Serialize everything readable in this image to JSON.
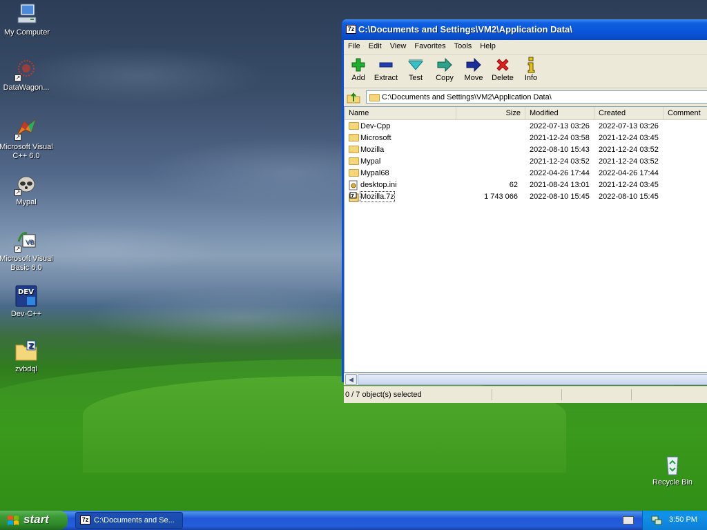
{
  "desktop": {
    "icons": [
      {
        "label": "My Computer"
      },
      {
        "label": "DataWagon..."
      },
      {
        "label": "Microsoft Visual C++ 6.0"
      },
      {
        "label": "Mypal"
      },
      {
        "label": "Microsoft Visual Basic 6.0"
      },
      {
        "label": "Dev-C++"
      },
      {
        "label": "zvbdql"
      },
      {
        "label": "Recycle Bin"
      }
    ]
  },
  "window": {
    "title": "C:\\Documents and Settings\\VM2\\Application Data\\",
    "app_badge": "7z",
    "menu": [
      "File",
      "Edit",
      "View",
      "Favorites",
      "Tools",
      "Help"
    ],
    "toolbar": [
      "Add",
      "Extract",
      "Test",
      "Copy",
      "Move",
      "Delete",
      "Info"
    ],
    "address": "C:\\Documents and Settings\\VM2\\Application Data\\",
    "columns": [
      "Name",
      "Size",
      "Modified",
      "Created",
      "Comment"
    ],
    "rows": [
      {
        "name": "Dev-Cpp",
        "size": "",
        "modified": "2022-07-13 03:26",
        "created": "2022-07-13 03:26",
        "type": "folder"
      },
      {
        "name": "Microsoft",
        "size": "",
        "modified": "2021-12-24 03:58",
        "created": "2021-12-24 03:45",
        "type": "folder"
      },
      {
        "name": "Mozilla",
        "size": "",
        "modified": "2022-08-10 15:43",
        "created": "2021-12-24 03:52",
        "type": "folder"
      },
      {
        "name": "Mypal",
        "size": "",
        "modified": "2021-12-24 03:52",
        "created": "2021-12-24 03:52",
        "type": "folder"
      },
      {
        "name": "Mypal68",
        "size": "",
        "modified": "2022-04-26 17:44",
        "created": "2022-04-26 17:44",
        "type": "folder"
      },
      {
        "name": "desktop.ini",
        "size": "62",
        "modified": "2021-08-24 13:01",
        "created": "2021-12-24 03:45",
        "type": "ini"
      },
      {
        "name": "Mozilla.7z",
        "size": "1 743 066",
        "modified": "2022-08-10 15:45",
        "created": "2022-08-10 15:45",
        "type": "7z"
      }
    ],
    "status": "0 / 7 object(s) selected"
  },
  "taskbar": {
    "start_label": "start",
    "task_label": "C:\\Documents and Se...",
    "clock": "3:50 PM"
  },
  "colors": {
    "titlebar": "#0a55d9",
    "taskbar": "#245edb",
    "start": "#3d9b36",
    "window_bg": "#ece9d8"
  }
}
